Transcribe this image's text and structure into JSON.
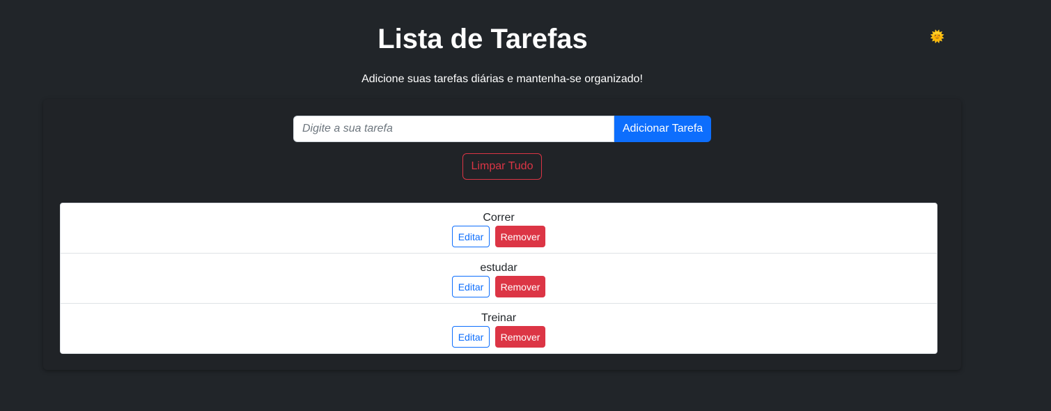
{
  "header": {
    "title": "Lista de Tarefas",
    "subtitle": "Adicione suas tarefas diárias e mantenha-se organizado!",
    "theme_toggle_glyph": "🌞",
    "theme_toggle_icon": "sun-icon",
    "theme_toggle_color": "#f7d117"
  },
  "form": {
    "input_placeholder": "Digite a sua tarefa",
    "input_value": "",
    "add_label": "Adicionar Tarefa",
    "clear_label": "Limpar Tudo"
  },
  "tasks": [
    {
      "text": "Correr",
      "edit_label": "Editar",
      "remove_label": "Remover"
    },
    {
      "text": "estudar",
      "edit_label": "Editar",
      "remove_label": "Remover"
    },
    {
      "text": "Treinar",
      "edit_label": "Editar",
      "remove_label": "Remover"
    }
  ],
  "colors": {
    "background": "#212529",
    "primary": "#0d6efd",
    "danger": "#dc3545"
  }
}
